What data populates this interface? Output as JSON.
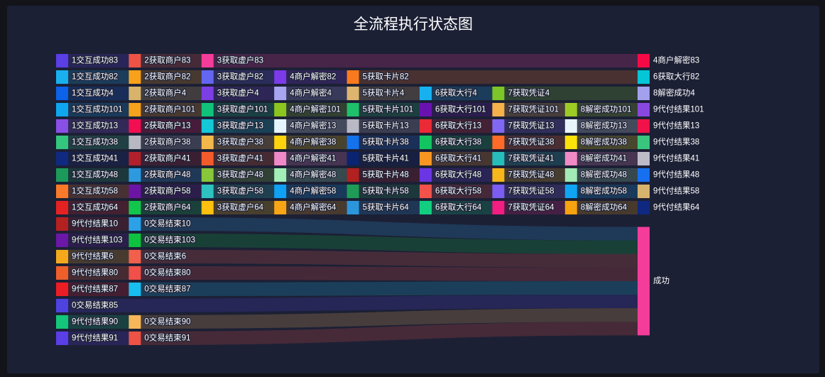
{
  "chart_data": {
    "type": "sankey",
    "title": "全流程执行状态图",
    "colors": [
      "#5a3ee6",
      "#ef5346",
      "#f43c9a",
      "#f50a45",
      "#1ab0ee",
      "#f7a21a",
      "#6366f1",
      "#7b3be8",
      "#f97a1e",
      "#04c6d7",
      "#0c62e8",
      "#d8b46a",
      "#7b3fe4",
      "#a8a4f0",
      "#ddb56e",
      "#18b1f0",
      "#7cc62a",
      "#a3a0ee",
      "#0fa6ef",
      "#f5a21d",
      "#10c27a",
      "#8dc520",
      "#1ec06a",
      "#6a12b0",
      "#f5b24b",
      "#9ccb25",
      "#8848e0",
      "#8a4fe4",
      "#f20e50",
      "#15c8d8",
      "#e5f5fb",
      "#b9b9c5",
      "#ea2a36",
      "#8068f2",
      "#e8f6fc",
      "#f01248",
      "#34c57e",
      "#b8b8c2",
      "#f3b84a",
      "#fdd30e",
      "#1372ec",
      "#12c561",
      "#fe6b28",
      "#fbe20a",
      "#39c57e",
      "#0f2a80",
      "#b2202c",
      "#f35b2a",
      "#f089c8",
      "#0b2471",
      "#f99521",
      "#26bdbb",
      "#f38ac8",
      "#bdbbc8",
      "#1c9a5a",
      "#2d9ae0",
      "#88c63a",
      "#a2efb8",
      "#b22020",
      "#6a36e3",
      "#f7b61b",
      "#a2eab6",
      "#1770f0",
      "#fb7a2a",
      "#6c14a4",
      "#2dc2c0",
      "#10a0f4",
      "#1e9b56",
      "#f2524a",
      "#7b5df2",
      "#10a5f4",
      "#d7b46e",
      "#e52222",
      "#12c64c",
      "#ffc010",
      "#f9a516",
      "#2b96dc",
      "#12ce80",
      "#f21e82",
      "#f5a30e",
      "#0f2980",
      "#b32121",
      "#2ca1e8",
      "#6b17a8",
      "#0ec240",
      "#f4a91c",
      "#f1604c",
      "#ee5f2a",
      "#f14f49",
      "#ec1d24",
      "#18bef0",
      "#4e43e0",
      "#14c67a",
      "#f7b65a"
    ],
    "nodes": [
      "1交互成功83",
      "2获取商户83",
      "3获取虚户83",
      "4商户解密83",
      "1交互成功82",
      "2获取商户82",
      "3获取虚户82",
      "4商户解密82",
      "5获取卡片82",
      "6获取大行82",
      "1交互成功4",
      "2获取商户4",
      "3获取虚户4",
      "4商户解密4",
      "5获取卡片4",
      "6获取大行4",
      "7获取凭证4",
      "8解密成功4",
      "1交互成功101",
      "2获取商户101",
      "3获取虚户101",
      "4商户解密101",
      "5获取卡片101",
      "6获取大行101",
      "7获取凭证101",
      "8解密成功101",
      "9代付结果101",
      "1交互成功13",
      "2获取商户13",
      "3获取虚户13",
      "4商户解密13",
      "5获取卡片13",
      "6获取大行13",
      "7获取凭证13",
      "8解密成功13",
      "9代付结果13",
      "1交互成功38",
      "2获取商户38",
      "3获取虚户38",
      "4商户解密38",
      "5获取卡片38",
      "6获取大行38",
      "7获取凭证38",
      "8解密成功38",
      "9代付结果38",
      "1交互成功41",
      "2获取商户41",
      "3获取虚户41",
      "4商户解密41",
      "5获取卡片41",
      "6获取大行41",
      "7获取凭证41",
      "8解密成功41",
      "9代付结果41",
      "1交互成功48",
      "2获取商户48",
      "3获取虚户48",
      "4商户解密48",
      "5获取卡片48",
      "6获取大行48",
      "7获取凭证48",
      "8解密成功48",
      "9代付结果48",
      "1交互成功58",
      "2获取商户58",
      "3获取虚户58",
      "4商户解密58",
      "5获取卡片58",
      "6获取大行58",
      "7获取凭证58",
      "8解密成功58",
      "9代付结果58",
      "1交互成功64",
      "2获取商户64",
      "3获取虚户64",
      "4商户解密64",
      "5获取卡片64",
      "6获取大行64",
      "7获取凭证64",
      "8解密成功64",
      "9代付结果64",
      "9代付结果10",
      "0交易结束10",
      "9代付结果103",
      "0交易结束103",
      "9代付结果6",
      "0交易结束6",
      "9代付结果80",
      "0交易结束80",
      "9代付结果87",
      "0交易结束87",
      "0交易结束85",
      "9代付结果90",
      "0交易结束90",
      "9代付结果91",
      "0交易结束91",
      "成功"
    ],
    "links": [
      {
        "chain": [
          "1交互成功83",
          "2获取商户83",
          "3获取虚户83",
          "4商户解密83"
        ],
        "value": 1
      },
      {
        "chain": [
          "1交互成功82",
          "2获取商户82",
          "3获取虚户82",
          "4商户解密82",
          "5获取卡片82",
          "6获取大行82"
        ],
        "value": 1
      },
      {
        "chain": [
          "1交互成功4",
          "2获取商户4",
          "3获取虚户4",
          "4商户解密4",
          "5获取卡片4",
          "6获取大行4",
          "7获取凭证4",
          "8解密成功4"
        ],
        "value": 1
      },
      {
        "chain": [
          "1交互成功101",
          "2获取商户101",
          "3获取虚户101",
          "4商户解密101",
          "5获取卡片101",
          "6获取大行101",
          "7获取凭证101",
          "8解密成功101",
          "9代付结果101"
        ],
        "value": 1
      },
      {
        "chain": [
          "1交互成功13",
          "2获取商户13",
          "3获取虚户13",
          "4商户解密13",
          "5获取卡片13",
          "6获取大行13",
          "7获取凭证13",
          "8解密成功13",
          "9代付结果13"
        ],
        "value": 1
      },
      {
        "chain": [
          "1交互成功38",
          "2获取商户38",
          "3获取虚户38",
          "4商户解密38",
          "5获取卡片38",
          "6获取大行38",
          "7获取凭证38",
          "8解密成功38",
          "9代付结果38"
        ],
        "value": 1
      },
      {
        "chain": [
          "1交互成功41",
          "2获取商户41",
          "3获取虚户41",
          "4商户解密41",
          "5获取卡片41",
          "6获取大行41",
          "7获取凭证41",
          "8解密成功41",
          "9代付结果41"
        ],
        "value": 1
      },
      {
        "chain": [
          "1交互成功48",
          "2获取商户48",
          "3获取虚户48",
          "4商户解密48",
          "5获取卡片48",
          "6获取大行48",
          "7获取凭证48",
          "8解密成功48",
          "9代付结果48"
        ],
        "value": 1
      },
      {
        "chain": [
          "1交互成功58",
          "2获取商户58",
          "3获取虚户58",
          "4商户解密58",
          "5获取卡片58",
          "6获取大行58",
          "7获取凭证58",
          "8解密成功58",
          "9代付结果58"
        ],
        "value": 1
      },
      {
        "chain": [
          "1交互成功64",
          "2获取商户64",
          "3获取虚户64",
          "4商户解密64",
          "5获取卡片64",
          "6获取大行64",
          "7获取凭证64",
          "8解密成功64",
          "9代付结果64"
        ],
        "value": 1
      },
      {
        "chain": [
          "9代付结果10",
          "0交易结束10",
          "成功"
        ],
        "value": 1
      },
      {
        "chain": [
          "9代付结果103",
          "0交易结束103",
          "成功"
        ],
        "value": 1
      },
      {
        "chain": [
          "9代付结果6",
          "0交易结束6",
          "成功"
        ],
        "value": 1
      },
      {
        "chain": [
          "9代付结果80",
          "0交易结束80",
          "成功"
        ],
        "value": 1
      },
      {
        "chain": [
          "9代付结果87",
          "0交易结束87",
          "成功"
        ],
        "value": 1
      },
      {
        "chain": [
          "0交易结束85",
          "成功"
        ],
        "value": 1
      },
      {
        "chain": [
          "9代付结果90",
          "0交易结束90",
          "成功"
        ],
        "value": 1
      },
      {
        "chain": [
          "9代付结果91",
          "0交易结束91",
          "成功"
        ],
        "value": 1
      }
    ]
  }
}
